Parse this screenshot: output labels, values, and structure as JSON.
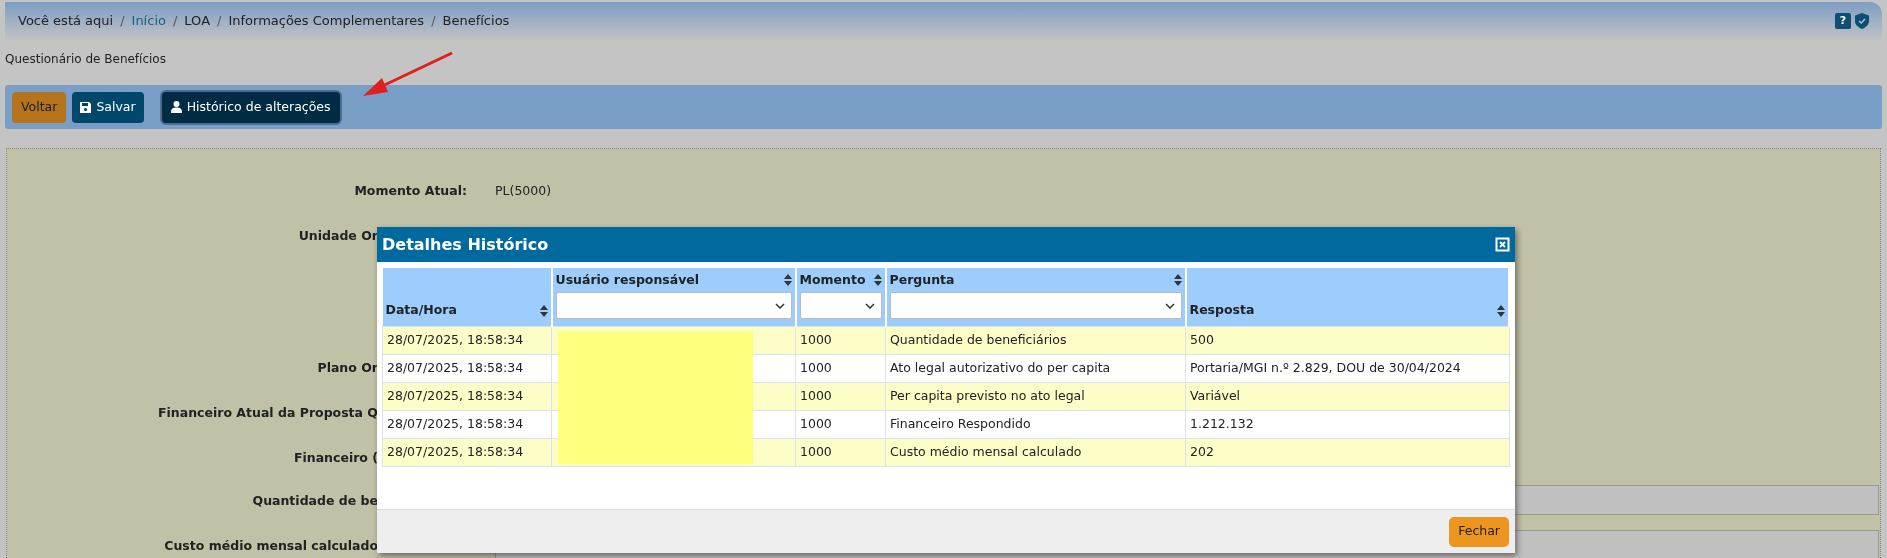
{
  "breadcrumb": {
    "prefix": "Você está aqui",
    "items": [
      {
        "label": "Início",
        "link": true
      },
      {
        "label": "LOA",
        "link": false
      },
      {
        "label": "Informações Complementares",
        "link": false
      },
      {
        "label": "Benefícios",
        "link": false
      }
    ],
    "separator": "/",
    "help": "?"
  },
  "page_title": "Questionário de Benefícios",
  "toolbar": [
    {
      "label": "Voltar",
      "kind": "back"
    },
    {
      "label": "Salvar",
      "kind": "save"
    },
    {
      "label": "Histórico de alterações",
      "kind": "history"
    }
  ],
  "form": [
    {
      "label": "Momento Atual:",
      "value": "PL(5000)",
      "kind": "text"
    },
    {
      "label": "Unidade Or",
      "kind": "covered"
    },
    {
      "label": "Plano Or",
      "kind": "covered"
    },
    {
      "label": "Financeiro Atual da Proposta Q",
      "kind": "covered"
    },
    {
      "label": "Financeiro (",
      "kind": "covered"
    },
    {
      "label": "Quantidade de be",
      "kind": "covered_input"
    },
    {
      "label": "Custo médio mensal calculado",
      "kind": "covered_input"
    }
  ],
  "dialog": {
    "title": "Detalhes Histórico",
    "columns": [
      {
        "label": "Data/Hora",
        "filter": false
      },
      {
        "label": "Usuário responsável",
        "filter": true
      },
      {
        "label": "Momento",
        "filter": true
      },
      {
        "label": "Pergunta",
        "filter": true
      },
      {
        "label": "Resposta",
        "filter": false
      }
    ],
    "rows": [
      {
        "datetime": "28/07/2025, 18:58:34",
        "momento": "1000",
        "pergunta": "Quantidade de beneficiários",
        "resposta": "500"
      },
      {
        "datetime": "28/07/2025, 18:58:34",
        "momento": "1000",
        "pergunta": "Ato legal autorizativo do per capita",
        "resposta": "Portaria/MGI n.º 2.829, DOU de 30/04/2024"
      },
      {
        "datetime": "28/07/2025, 18:58:34",
        "momento": "1000",
        "pergunta": "Per capita previsto no ato legal",
        "resposta": "Variável"
      },
      {
        "datetime": "28/07/2025, 18:58:34",
        "momento": "1000",
        "pergunta": "Financeiro Respondido",
        "resposta": "1.212.132"
      },
      {
        "datetime": "28/07/2025, 18:58:34",
        "momento": "1000",
        "pergunta": "Custo médio mensal calculado",
        "resposta": "202"
      }
    ],
    "close_button": "Fechar"
  }
}
